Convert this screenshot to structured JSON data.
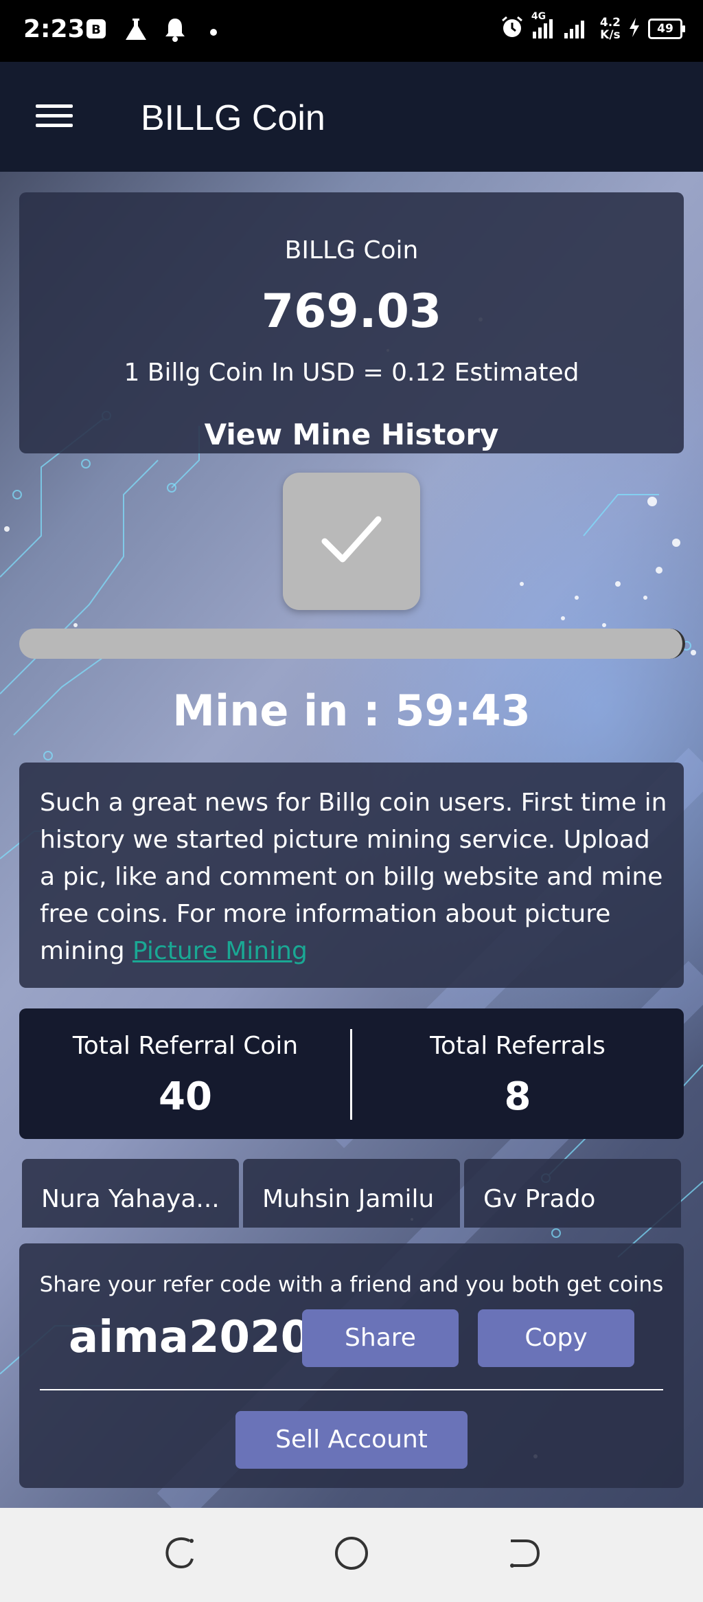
{
  "status_bar": {
    "time": "2:23",
    "network_type": "4G",
    "net_speed_value": "4.2",
    "net_speed_unit": "K/s",
    "battery": "49",
    "icons": [
      "b-badge-icon",
      "flask-icon",
      "bell-icon",
      "dot-icon",
      "alarm-icon",
      "signal-icon",
      "charging-icon",
      "battery-icon"
    ]
  },
  "app_bar": {
    "title": "BILLG Coin",
    "menu_icon": "hamburger-menu-icon"
  },
  "balance": {
    "title": "BILLG Coin",
    "amount": "769.03",
    "usd_rate": "1 Billg Coin In USD = 0.12 Estimated",
    "history_link": "View Mine History"
  },
  "mining": {
    "button_icon": "checkmark-icon",
    "progress": 1.0,
    "timer_text": "Mine in : 59:43"
  },
  "news": {
    "text": "Such a great news for Billg coin users. First time in history we started picture mining service. Upload a pic, like and comment on billg website and mine free coins. For more information about picture mining ",
    "link_text": "Picture Mining"
  },
  "referrals": {
    "coin_label": "Total Referral Coin",
    "coin_value": "40",
    "count_label": "Total Referrals",
    "count_value": "8",
    "names": [
      "Nura Yahaya...",
      "Muhsin Jamilu",
      "Gv Prado"
    ]
  },
  "share": {
    "hint": "Share your refer code with a friend and you both get coins",
    "code": "aima2020",
    "share_label": "Share",
    "copy_label": "Copy",
    "sell_label": "Sell Account"
  },
  "colors": {
    "app_bar": "#141b2e",
    "button": "#6a73b8",
    "link": "#1aa894",
    "card": "#2a3048"
  }
}
